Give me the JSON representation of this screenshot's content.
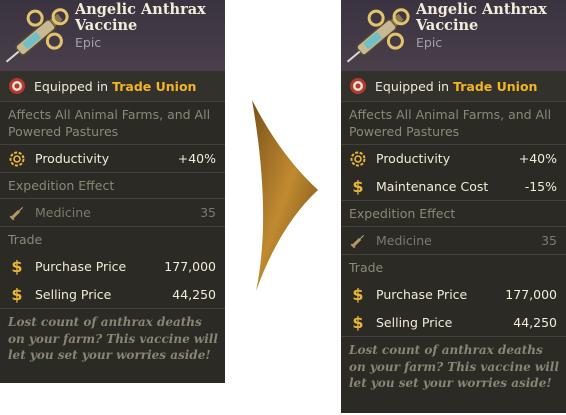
{
  "before": {
    "title": "Angelic Anthrax Vaccine",
    "rarity": "Epic",
    "equipped_prefix": "Equipped in",
    "equipped_target": "Trade Union",
    "affects": "Affects All Animal Farms, and All Powered Pastures",
    "stats": [
      {
        "icon": "gear-icon",
        "name": "Productivity",
        "value": "+40%"
      }
    ],
    "expedition_label": "Expedition Effect",
    "expedition": {
      "icon": "syringe-icon",
      "name": "Medicine",
      "value": "35"
    },
    "trade_label": "Trade",
    "trade": [
      {
        "icon": "dollar-icon",
        "name": "Purchase Price",
        "value": "177,000"
      },
      {
        "icon": "dollar-icon",
        "name": "Selling Price",
        "value": "44,250"
      }
    ],
    "flavor": "Lost count of anthrax deaths on your farm? This vaccine will let you set your worries aside!"
  },
  "after": {
    "title": "Angelic Anthrax Vaccine",
    "rarity": "Epic",
    "equipped_prefix": "Equipped in",
    "equipped_target": "Trade Union",
    "affects": "Affects All Animal Farms, and All Powered Pastures",
    "stats": [
      {
        "icon": "gear-icon",
        "name": "Productivity",
        "value": "+40%"
      },
      {
        "icon": "dollar-icon",
        "name": "Maintenance Cost",
        "value": "-15%"
      }
    ],
    "expedition_label": "Expedition Effect",
    "expedition": {
      "icon": "syringe-icon",
      "name": "Medicine",
      "value": "35"
    },
    "trade_label": "Trade",
    "trade": [
      {
        "icon": "dollar-icon",
        "name": "Purchase Price",
        "value": "177,000"
      },
      {
        "icon": "dollar-icon",
        "name": "Selling Price",
        "value": "44,250"
      }
    ],
    "flavor": "Lost count of anthrax deaths on your farm? This vaccine will let you set your worries aside!"
  },
  "colors": {
    "highlight": "#f2b523",
    "card_bg": "#2b2a24",
    "header_bg": "#4a3f4b",
    "arrow": "#b07a24"
  }
}
